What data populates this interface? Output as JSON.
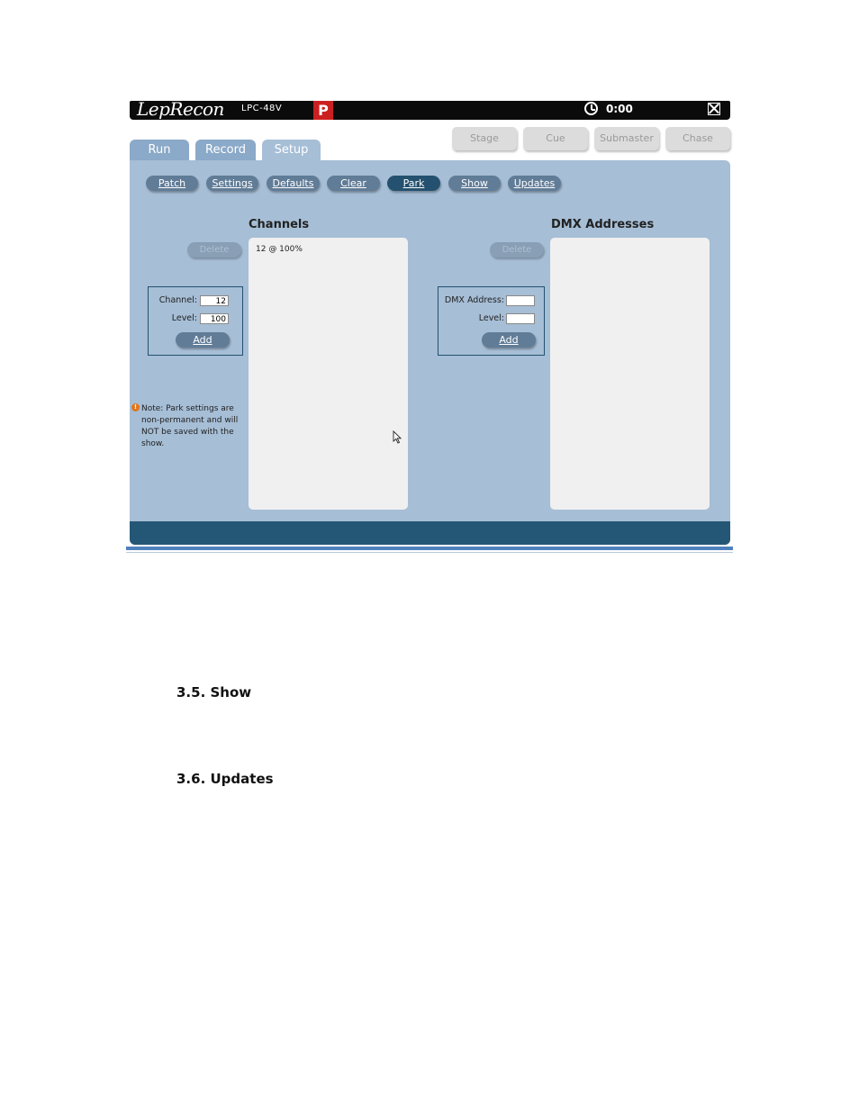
{
  "app": {
    "logo": "LepRecon",
    "model": "LPC-48V",
    "badge": "P",
    "clock": "0:00",
    "main_tabs": [
      {
        "label": "Run"
      },
      {
        "label": "Record"
      },
      {
        "label": "Setup"
      }
    ],
    "mode_buttons": [
      {
        "label": "Stage"
      },
      {
        "label": "Cue"
      },
      {
        "label": "Submaster"
      },
      {
        "label": "Chase"
      }
    ],
    "sub_tabs": [
      {
        "label": "Patch"
      },
      {
        "label": "Settings"
      },
      {
        "label": "Defaults"
      },
      {
        "label": "Clear"
      },
      {
        "label": "Park"
      },
      {
        "label": "Show"
      },
      {
        "label": "Updates"
      }
    ],
    "channels": {
      "title": "Channels",
      "delete_label": "Delete",
      "items": [
        "12 @ 100%"
      ],
      "channel_label": "Channel:",
      "channel_value": "12",
      "level_label": "Level:",
      "level_value": "100",
      "add_label": "Add"
    },
    "dmx": {
      "title": "DMX Addresses",
      "delete_label": "Delete",
      "address_label": "DMX Address:",
      "address_value": "",
      "level_label": "Level:",
      "level_value": "",
      "add_label": "Add"
    },
    "note": "Note: Park settings are non-permanent and will NOT be saved with the show."
  },
  "document": {
    "heading_show": "3.5. Show",
    "heading_updates": "3.6. Updates"
  }
}
